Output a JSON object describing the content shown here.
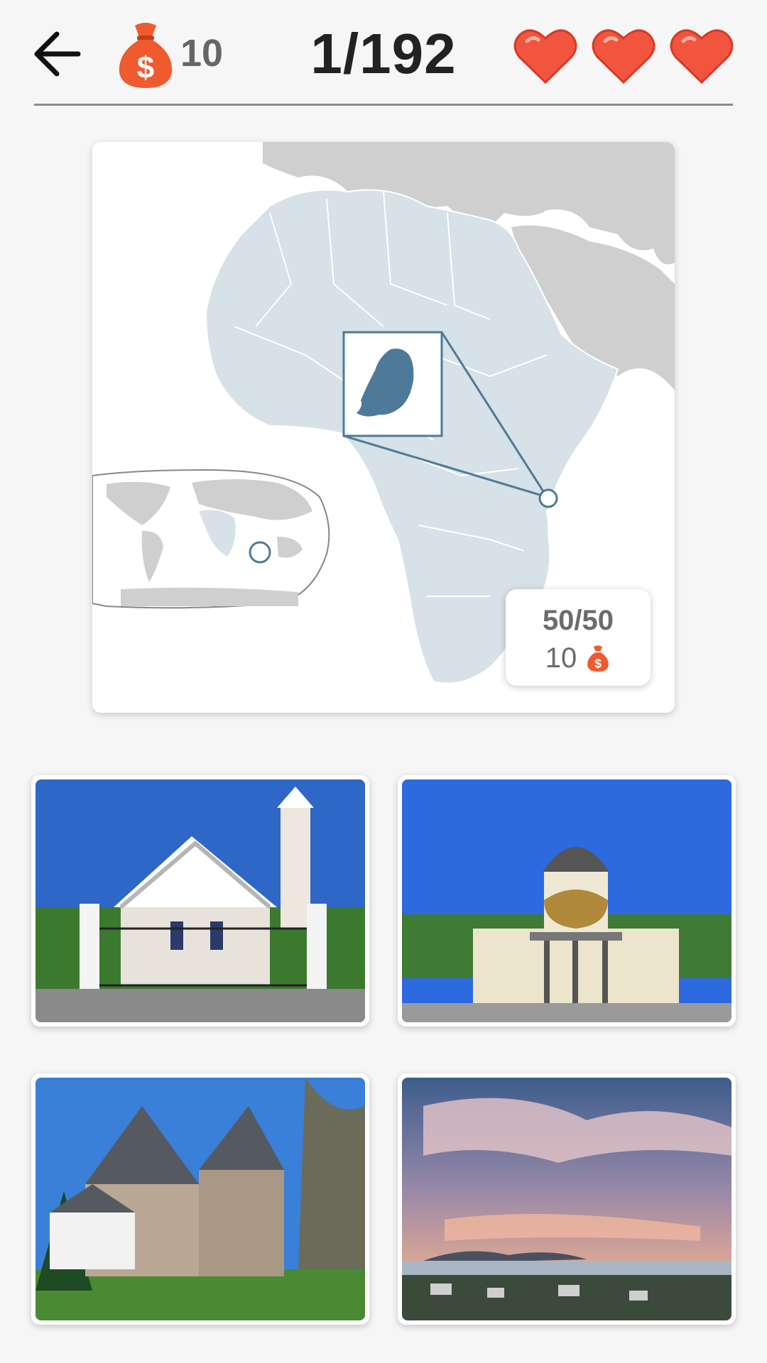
{
  "header": {
    "coins": "10",
    "level": "1/192",
    "lives": 3
  },
  "map": {
    "reward_progress": "50/50",
    "reward_coins": "10"
  },
  "options": [
    {
      "subject": "church-with-angel-statues-and-bell-tower"
    },
    {
      "subject": "domed-cathedral-with-bell-pavilion"
    },
    {
      "subject": "stone-romanesque-church"
    },
    {
      "subject": "coastal-city-under-dramatic-sky"
    }
  ],
  "colors": {
    "heart": "#f2553d",
    "money_bag": "#ef5a2f",
    "africa_fill": "#d6e1e8",
    "highlight": "#4e7a99",
    "other_land": "#cfcfcf"
  }
}
